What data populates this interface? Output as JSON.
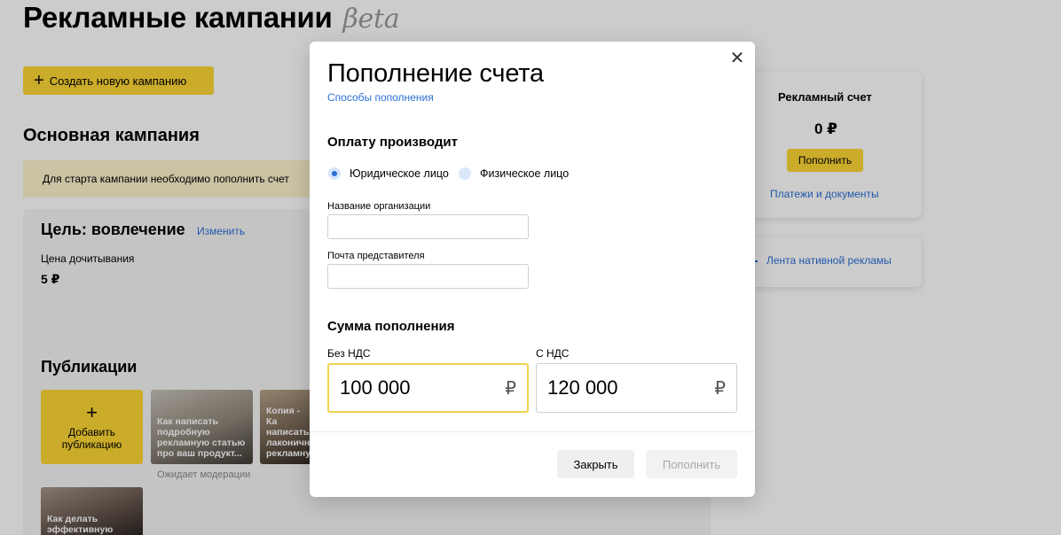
{
  "page": {
    "title": "Рекламные кампании",
    "beta": "βeta",
    "create_button": "Создать новую кампанию",
    "campaign_title": "Основная кампания",
    "alert": "Для старта кампании необходимо пополнить счет",
    "goal_title": "Цель: вовлечение",
    "goal_edit": "Изменить",
    "price_label": "Цена дочитывания",
    "price_value": "5 ₽",
    "publications_title": "Публикации",
    "add_publication": "Добавить публикацию",
    "publications": [
      {
        "caption": "Как написать подробную рекламную статью про ваш продукт...",
        "status": "Ожидает модерации"
      },
      {
        "caption": "Копия - Ка написать лаконичн рекламну"
      },
      {
        "caption": "Как делать эффективную"
      }
    ],
    "account": {
      "title": "Рекламный счет",
      "balance": "0 ₽",
      "topup_button": "Пополнить",
      "payments_link": "Платежи и документы"
    },
    "native_feed_link": "Лента нативной рекламы"
  },
  "modal": {
    "title": "Пополнение счета",
    "methods_link": "Способы пополнения",
    "payer_title": "Оплату производит",
    "payer_options": [
      {
        "label": "Юридическое лицо",
        "selected": true
      },
      {
        "label": "Физическое лицо",
        "selected": false
      }
    ],
    "org_name_label": "Название организации",
    "org_name_value": "",
    "email_label": "Почта представителя",
    "email_value": "",
    "sum_title": "Сумма пополнения",
    "amount_no_vat_label": "Без НДС",
    "amount_no_vat_value": "100 000",
    "amount_vat_label": "С НДС",
    "amount_vat_value": "120 000",
    "currency": "₽",
    "close_button": "Закрыть",
    "submit_button": "Пополнить"
  },
  "colors": {
    "accent_yellow": "#fdd835",
    "link_blue": "#2b6fd6",
    "focus_border": "#f2d14f",
    "overlay": "rgba(0,0,0,0.20)"
  }
}
